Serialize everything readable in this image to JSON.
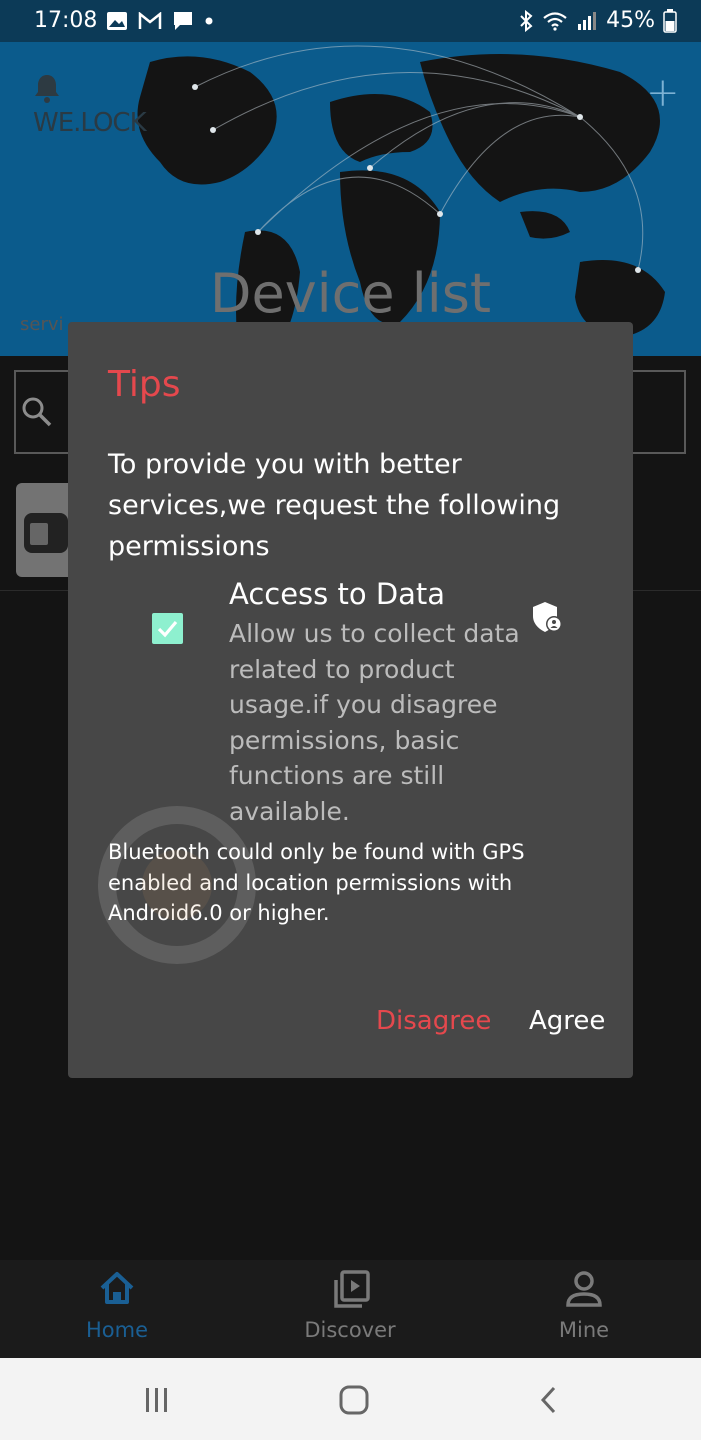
{
  "status_bar": {
    "time": "17:08",
    "battery": "45%",
    "icons": [
      "image-icon",
      "gmail-icon",
      "message-icon",
      "dot-icon",
      "bluetooth-icon",
      "wifi-icon",
      "signal-icon",
      "battery-icon"
    ]
  },
  "header": {
    "brand": "WE.LOCK",
    "title": "Device list",
    "subtext": "servi"
  },
  "dialog": {
    "title": "Tips",
    "intro": "To provide you with better services,we request the following permissions",
    "permission": {
      "checked": true,
      "title": "Access to Data",
      "description": "Allow us to collect data related to product usage.if you disagree permissions, basic functions are still available."
    },
    "note": "Bluetooth could only be found with GPS enabled and location permissions with Android6.0 or higher.",
    "disagree_label": "Disagree",
    "agree_label": "Agree"
  },
  "tabs": [
    {
      "label": "Home",
      "icon": "home-icon",
      "active": true
    },
    {
      "label": "Discover",
      "icon": "play-library-icon",
      "active": false
    },
    {
      "label": "Mine",
      "icon": "person-icon",
      "active": false
    }
  ],
  "colors": {
    "header_blue": "#0b5b8c",
    "accent_red": "#e5484d",
    "tab_active": "#1a5f94",
    "tab_inactive": "#7a7a7a",
    "checkbox": "#8ef0cf",
    "dialog_bg": "#474747"
  }
}
